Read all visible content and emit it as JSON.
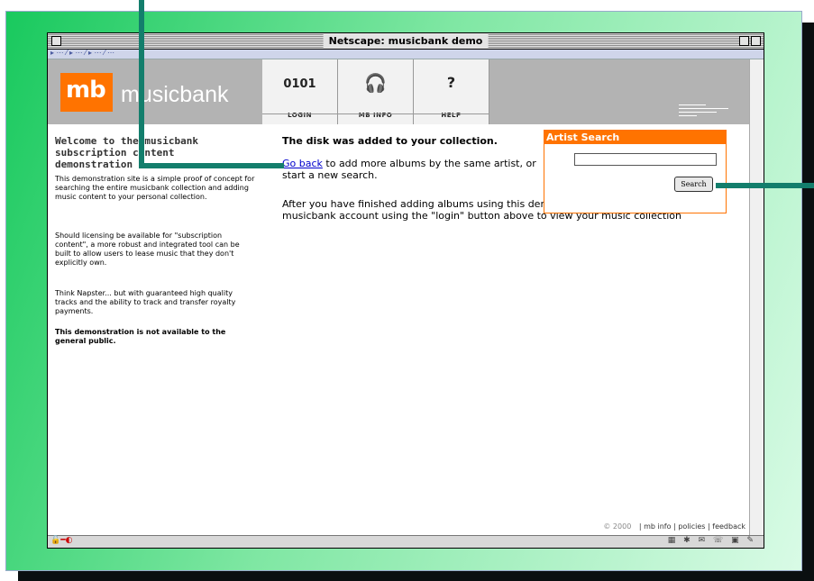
{
  "window": {
    "title": "Netscape: musicbank demo"
  },
  "logo": {
    "mb": "mb",
    "name": "musicbank"
  },
  "nav": [
    {
      "glyph": "0101",
      "label": "LOGIN"
    },
    {
      "glyph": "🎧",
      "label": "MB INFO"
    },
    {
      "glyph": "?",
      "label": "HELP"
    }
  ],
  "sidebar": {
    "title": "Welcome to the musicbank subscription content demonstration",
    "p1": "This demonstration site is a simple proof of concept for searching the entire musicbank collection and adding music content to your personal collection.",
    "p2": "Should licensing be available for \"subscription content\", a more robust and integrated tool can be built to allow users to lease music that they don't explicitly own.",
    "p3": "Think Napster... but with guaranteed high quality tracks and the ability to track and transfer royalty payments.",
    "p4": "This demonstration is not available to the general public."
  },
  "main": {
    "title": "The disk was added to your collection.",
    "go_back_link": "Go back",
    "p1_rest": " to add more albums by the same artist, or start a new search.",
    "p2": "After you have finished adding albums using this demonstration, log in to your musicbank account using the \"login\" button above to view your music collection"
  },
  "search": {
    "title": "Artist Search",
    "input_value": "",
    "button_label": "Search"
  },
  "footer": {
    "copyright": "© 2000",
    "sep": "|",
    "links": [
      "mb info",
      "policies",
      "feedback"
    ]
  },
  "icons": {
    "lock": "lock-icon",
    "status": "status-icons"
  },
  "colors": {
    "accent": "#ff7300",
    "callout": "#137e6c",
    "link": "#0000cc"
  }
}
